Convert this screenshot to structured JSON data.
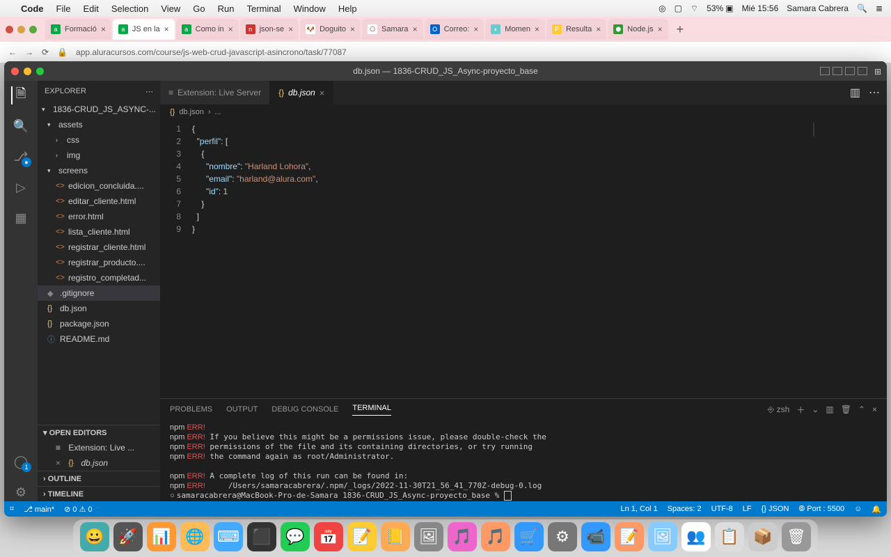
{
  "menubar": {
    "app": "Code",
    "items": [
      "File",
      "Edit",
      "Selection",
      "View",
      "Go",
      "Run",
      "Terminal",
      "Window",
      "Help"
    ],
    "battery": "53%",
    "time": "Mié 15:56",
    "user": "Samara Cabrera"
  },
  "chrome": {
    "tabs": [
      "Formació",
      "JS en la",
      "Como in",
      "json-se",
      "Doguito",
      "Samara",
      "Correo:",
      "Momen",
      "Resulta",
      "Node.js"
    ],
    "active_index": 1,
    "url": "app.aluracursos.com/course/js-web-crud-javascript-asincrono/task/77087"
  },
  "vscode": {
    "title": "db.json — 1836-CRUD_JS_Async-proyecto_base",
    "explorer": {
      "title": "EXPLORER",
      "project": "1836-CRUD_JS_ASYNC-...",
      "folders": {
        "assets": {
          "children": [
            "css",
            "img"
          ]
        },
        "screens": {
          "files": [
            "edicion_concluida....",
            "editar_cliente.html",
            "error.html",
            "lista_cliente.html",
            "registrar_cliente.html",
            "registrar_producto....",
            "registro_completad..."
          ]
        }
      },
      "root_files": [
        ".gitignore",
        "db.json",
        "package.json",
        "README.md"
      ],
      "sections": [
        "OPEN EDITORS",
        "OUTLINE",
        "TIMELINE"
      ],
      "open_editors": [
        "Extension: Live ...",
        "db.json"
      ]
    },
    "tabs": [
      {
        "label": "Extension: Live Server",
        "icon": "≡",
        "active": false
      },
      {
        "label": "db.json",
        "icon": "{}",
        "active": true
      }
    ],
    "breadcrumb": [
      "{} db.json",
      "..."
    ],
    "code": {
      "lines": [
        "{",
        "  \"perfil\": [",
        "    {",
        "      \"nombre\": \"Harland Lohora\",",
        "      \"email\": \"harland@alura.com\",",
        "      \"id\": 1",
        "    }",
        "  ]",
        "}"
      ]
    },
    "panel": {
      "tabs": [
        "PROBLEMS",
        "OUTPUT",
        "DEBUG CONSOLE",
        "TERMINAL"
      ],
      "active": 3,
      "shell": "zsh",
      "terminal_lines": [
        {
          "p": "npm ",
          "e": "ERR!",
          "t": ""
        },
        {
          "p": "npm ",
          "e": "ERR!",
          "t": " If you believe this might be a permissions issue, please double-check the"
        },
        {
          "p": "npm ",
          "e": "ERR!",
          "t": " permissions of the file and its containing directories, or try running"
        },
        {
          "p": "npm ",
          "e": "ERR!",
          "t": " the command again as root/Administrator."
        },
        {
          "p": "",
          "e": "",
          "t": ""
        },
        {
          "p": "npm ",
          "e": "ERR!",
          "t": " A complete log of this run can be found in:"
        },
        {
          "p": "npm ",
          "e": "ERR!",
          "t": "     /Users/samaracabrera/.npm/_logs/2022-11-30T21_56_41_770Z-debug-0.log"
        }
      ],
      "prompt": "samaracabrera@MacBook-Pro-de-Samara 1836-CRUD_JS_Async-proyecto_base % "
    },
    "status": {
      "left": [
        "⎇ main*",
        "⊘ 0 ⚠ 0"
      ],
      "right": [
        "Ln 1, Col 1",
        "Spaces: 2",
        "UTF-8",
        "LF",
        "{} JSON",
        "⦾ Port : 5500",
        "☺"
      ]
    }
  },
  "dock_icons": [
    "😀",
    "🚀",
    "📊",
    "🌐",
    "⌨",
    "⬛",
    "💬",
    "📅",
    "📝",
    "📒",
    "🖼",
    "🎵",
    "🎵",
    "🛒",
    "⚙",
    "📹",
    "📝",
    "🖼",
    "👥",
    "📋",
    "📦",
    "🗑"
  ]
}
